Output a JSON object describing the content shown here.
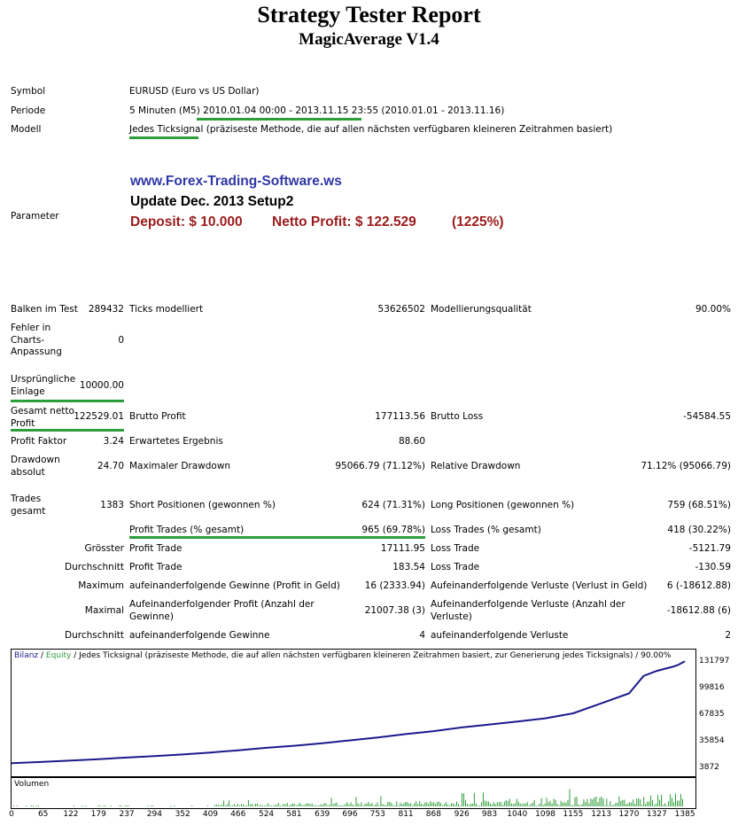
{
  "header": {
    "title": "Strategy Tester Report",
    "subtitle": "MagicAverage V1.4"
  },
  "info": {
    "symbol_label": "Symbol",
    "symbol_value": "EURUSD (Euro vs US Dollar)",
    "period_label": "Periode",
    "period_prefix": "5 Minuten (M5)",
    "period_range": "2010.01.04 00:00 - 2013.11.15 23:55",
    "period_suffix": "(2010.01.01 - 2013.11.16)",
    "model_label": "Modell",
    "model_name": "Jedes Ticksignal",
    "model_desc": "(präziseste Methode, die auf allen nächsten verfügbaren kleineren Zeitrahmen basiert)",
    "param_label": "Parameter"
  },
  "promo": {
    "link": "www.Forex-Trading-Software.ws",
    "update": "Update Dec. 2013  Setup2",
    "deposit": "Deposit: $ 10.000",
    "profit": "Netto Profit: $ 122.529",
    "percent": "(1225%)"
  },
  "stats": {
    "bars_label": "Balken im Test",
    "bars_value": "289432",
    "ticks_label": "Ticks modelliert",
    "ticks_value": "53626502",
    "quality_label": "Modellierungsqualität",
    "quality_value": "90.00%",
    "errors_label": "Fehler in Charts-Anpassung",
    "errors_value": "0",
    "deposit_label": "Ursprüngliche Einlage",
    "deposit_value": "10000.00",
    "net_label": "Gesamt netto Profit",
    "net_value": "122529.01",
    "gross_profit_label": "Brutto Profit",
    "gross_profit_value": "177113.56",
    "gross_loss_label": "Brutto Loss",
    "gross_loss_value": "-54584.55",
    "pf_label": "Profit Faktor",
    "pf_value": "3.24",
    "exp_label": "Erwartetes Ergebnis",
    "exp_value": "88.60",
    "dd_abs_label": "Drawdown absolut",
    "dd_abs_value": "24.70",
    "dd_max_label": "Maximaler Drawdown",
    "dd_max_value": "95066.79 (71.12%)",
    "dd_rel_label": "Relative Drawdown",
    "dd_rel_value": "71.12% (95066.79)",
    "trades_label": "Trades gesamt",
    "trades_value": "1383",
    "short_label": "Short Positionen (gewonnen %)",
    "short_value": "624 (71.31%)",
    "long_label": "Long Positionen (gewonnen %)",
    "long_value": "759 (68.51%)",
    "pt_label": "Profit Trades (% gesamt)",
    "pt_value": "965 (69.78%)",
    "lt_label": "Loss Trades (% gesamt)",
    "lt_value": "418 (30.22%)",
    "largest_label": "Grösster",
    "largest_pt_label": "Profit Trade",
    "largest_pt_value": "17111.95",
    "largest_lt_label": "Loss Trade",
    "largest_lt_value": "-5121.79",
    "avg_label": "Durchschnitt",
    "avg_pt_label": "Profit Trade",
    "avg_pt_value": "183.54",
    "avg_lt_label": "Loss Trade",
    "avg_lt_value": "-130.59",
    "max_label": "Maximum",
    "max_cw_label": "aufeinanderfolgende Gewinne (Profit in Geld)",
    "max_cw_value": "16 (2333.94)",
    "max_cl_label": "Aufeinanderfolgende Verluste (Verlust in Geld)",
    "max_cl_value": "6 (-18612.88)",
    "maximal_label": "Maximal",
    "maximal_cp_label": "Aufeinanderfolgender Profit (Anzahl der Gewinne)",
    "maximal_cp_value": "21007.38 (3)",
    "maximal_cl_label": "Aufeinanderfolgende Verluste (Anzahl der Verluste)",
    "maximal_cl_value": "-18612.88 (6)",
    "avg2_label": "Durchschnitt",
    "avg2_cw_label": "aufeinanderfolgende Gewinne",
    "avg2_cw_value": "4",
    "avg2_cl_label": "aufeinanderfolgende Verluste",
    "avg2_cl_value": "2"
  },
  "chart": {
    "legend_bilanz": "Bilanz",
    "legend_sep1": " / ",
    "legend_equity": "Equity",
    "legend_rest": " / Jedes  Ticksignal (präziseste Methode, die auf allen nächsten verfügbaren kleineren Zeitrahmen basiert, zur Generierung jedes Ticksignals) / 90.00%",
    "volume_label": "Volumen",
    "colors": {
      "balance": "#1a1a8c",
      "equity": "#2e9e3a"
    }
  },
  "chart_data": {
    "type": "line",
    "title": "",
    "y_ticks": [
      "131797",
      "99816",
      "67835",
      "35854",
      "3872"
    ],
    "ylim": [
      3872,
      131797
    ],
    "x_ticks": [
      "0",
      "65",
      "122",
      "179",
      "237",
      "294",
      "352",
      "409",
      "466",
      "524",
      "581",
      "639",
      "696",
      "753",
      "811",
      "868",
      "926",
      "983",
      "1040",
      "1098",
      "1155",
      "1213",
      "1270",
      "1327",
      "1385"
    ],
    "xlim": [
      0,
      1383
    ],
    "series": [
      {
        "name": "Bilanz",
        "x": [
          0,
          65,
          122,
          179,
          237,
          294,
          352,
          409,
          466,
          524,
          581,
          639,
          696,
          753,
          811,
          868,
          926,
          983,
          1040,
          1098,
          1155,
          1213,
          1270,
          1300,
          1327,
          1360,
          1370,
          1385
        ],
        "y": [
          10000,
          11500,
          13200,
          14800,
          16800,
          18600,
          20500,
          22800,
          25500,
          28500,
          31000,
          34000,
          37500,
          41000,
          45000,
          48500,
          53000,
          56500,
          60000,
          64000,
          70000,
          82000,
          94000,
          115000,
          121000,
          126000,
          128000,
          132529
        ]
      }
    ]
  }
}
